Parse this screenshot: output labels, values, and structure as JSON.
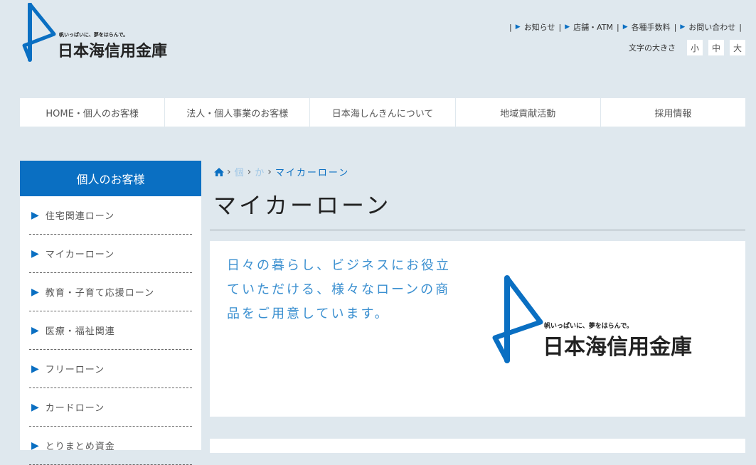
{
  "header": {
    "logo": {
      "tagline": "帆いっぱいに、夢をはらんで。",
      "name": "日本海信用金庫"
    },
    "util_links": [
      "お知らせ",
      "店舗・ATM",
      "各種手数料",
      "お問い合わせ"
    ],
    "font_size": {
      "label": "文字の大きさ",
      "options": [
        "小",
        "中",
        "大"
      ]
    }
  },
  "global_nav": [
    "HOME・個人のお客様",
    "法人・個人事業のお客様",
    "日本海しんきんについて",
    "地域貢献活動",
    "採用情報"
  ],
  "sidebar": {
    "title": "個人のお客様",
    "items": [
      "住宅関連ローン",
      "マイカーローン",
      "教育・子育て応援ローン",
      "医療・福祉関連",
      "フリーローン",
      "カードローン",
      "とりまとめ資金"
    ]
  },
  "breadcrumb": {
    "crumb1": "個",
    "crumb2": "か",
    "current": "マイカーローン"
  },
  "main": {
    "title": "マイカーローン",
    "lead": "日々の暮らし、ビジネスにお役立ていただける、様々なローンの商品をご用意しています。",
    "logo": {
      "tagline": "帆いっぱいに、夢をはらんで。",
      "name": "日本海信用金庫"
    }
  },
  "colors": {
    "brand_blue": "#0a6fc2",
    "lead_text": "#3a8fd0",
    "background": "#dfe8ee"
  }
}
